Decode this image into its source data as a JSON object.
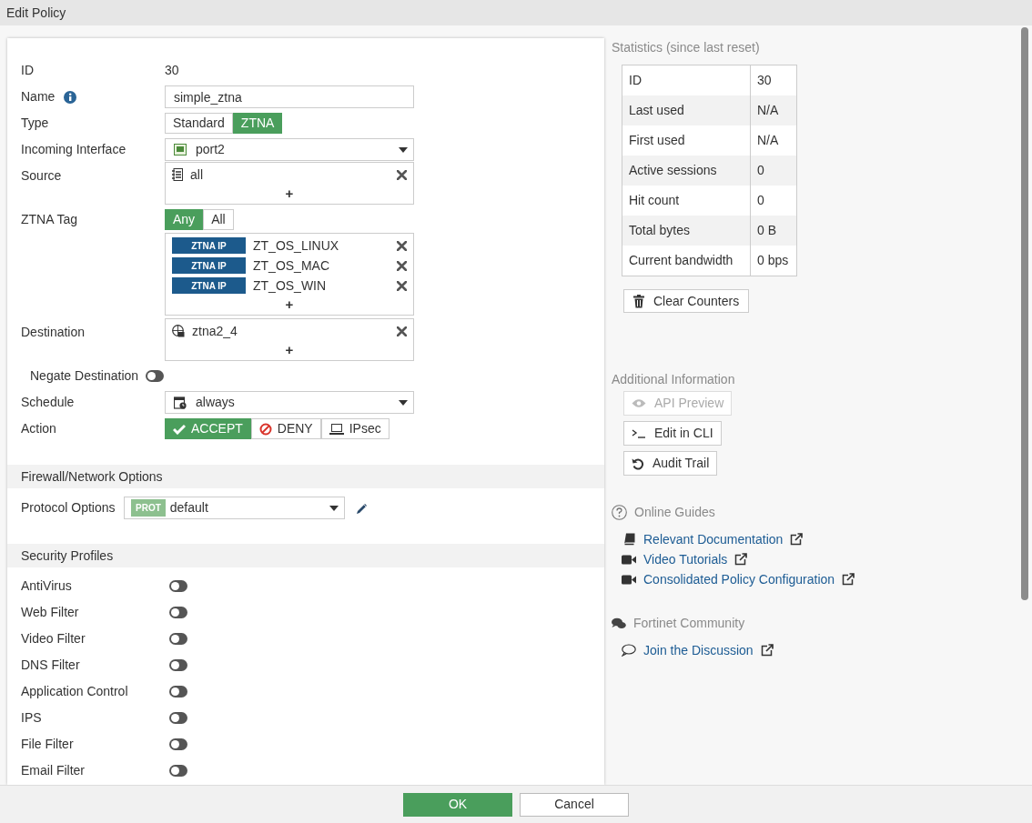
{
  "window": {
    "title": "Edit Policy"
  },
  "form": {
    "id": {
      "label": "ID",
      "value": "30"
    },
    "name": {
      "label": "Name",
      "value": "simple_ztna"
    },
    "type": {
      "label": "Type",
      "options": [
        {
          "label": "Standard",
          "selected": false
        },
        {
          "label": "ZTNA",
          "selected": true
        }
      ]
    },
    "incoming_interface": {
      "label": "Incoming Interface",
      "value": "port2"
    },
    "source": {
      "label": "Source",
      "items": [
        {
          "name": "all"
        }
      ],
      "add": "+"
    },
    "ztna_tag": {
      "label": "ZTNA Tag",
      "match": [
        {
          "label": "Any",
          "selected": true
        },
        {
          "label": "All",
          "selected": false
        }
      ],
      "items": [
        {
          "badge": "ZTNA IP",
          "name": "ZT_OS_LINUX"
        },
        {
          "badge": "ZTNA IP",
          "name": "ZT_OS_MAC"
        },
        {
          "badge": "ZTNA IP",
          "name": "ZT_OS_WIN"
        }
      ],
      "add": "+"
    },
    "destination": {
      "label": "Destination",
      "items": [
        {
          "name": "ztna2_4"
        }
      ],
      "add": "+"
    },
    "negate_destination": {
      "label": "Negate Destination",
      "on": false
    },
    "schedule": {
      "label": "Schedule",
      "value": "always"
    },
    "action": {
      "label": "Action",
      "options": [
        {
          "kind": "accept",
          "label": "ACCEPT",
          "selected": true
        },
        {
          "kind": "deny",
          "label": "DENY",
          "selected": false
        },
        {
          "kind": "ipsec",
          "label": "IPsec",
          "selected": false
        }
      ]
    }
  },
  "firewall_options": {
    "title": "Firewall/Network Options",
    "protocol_options": {
      "label": "Protocol Options",
      "badge": "PROT",
      "value": "default"
    }
  },
  "security_profiles": {
    "title": "Security Profiles",
    "items": [
      {
        "label": "AntiVirus",
        "on": false
      },
      {
        "label": "Web Filter",
        "on": false
      },
      {
        "label": "Video Filter",
        "on": false
      },
      {
        "label": "DNS Filter",
        "on": false
      },
      {
        "label": "Application Control",
        "on": false
      },
      {
        "label": "IPS",
        "on": false
      },
      {
        "label": "File Filter",
        "on": false
      },
      {
        "label": "Email Filter",
        "on": false
      }
    ]
  },
  "statistics": {
    "title": "Statistics (since last reset)",
    "rows": [
      {
        "label": "ID",
        "value": "30"
      },
      {
        "label": "Last used",
        "value": "N/A"
      },
      {
        "label": "First used",
        "value": "N/A"
      },
      {
        "label": "Active sessions",
        "value": "0"
      },
      {
        "label": "Hit count",
        "value": "0"
      },
      {
        "label": "Total bytes",
        "value": "0 B"
      },
      {
        "label": "Current bandwidth",
        "value": "0 bps"
      }
    ],
    "clear_button": "Clear Counters"
  },
  "additional_information": {
    "title": "Additional Information",
    "buttons": [
      {
        "kind": "eye",
        "label": "API Preview",
        "disabled": true
      },
      {
        "kind": "terminal",
        "label": "Edit in CLI",
        "disabled": false
      },
      {
        "kind": "history",
        "label": "Audit Trail",
        "disabled": false
      }
    ]
  },
  "online_guides": {
    "title": "Online Guides",
    "links": [
      {
        "kind": "book",
        "label": "Relevant Documentation"
      },
      {
        "kind": "video",
        "label": "Video Tutorials"
      },
      {
        "kind": "video",
        "label": "Consolidated Policy Configuration"
      }
    ]
  },
  "community": {
    "title": "Fortinet Community",
    "links": [
      {
        "kind": "chat",
        "label": "Join the Discussion"
      }
    ]
  },
  "footer": {
    "buttons": [
      {
        "kind": "primary",
        "label": "OK"
      },
      {
        "kind": "secondary",
        "label": "Cancel"
      }
    ]
  }
}
